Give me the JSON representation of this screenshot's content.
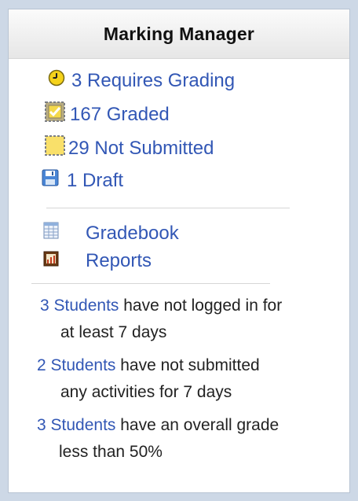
{
  "widget": {
    "title": "Marking Manager"
  },
  "grading": {
    "requires_grading": "3 Requires Grading",
    "graded": "167 Graded",
    "not_submitted": "29 Not Submitted",
    "draft": "1 Draft"
  },
  "tools": {
    "gradebook": "Gradebook",
    "reports": "Reports"
  },
  "alerts": [
    {
      "link": "3 Students",
      "line1": " have not logged in for",
      "line2": "at least 7 days"
    },
    {
      "link": "2 Students",
      "line1": " have not submitted",
      "line2": "any activities for 7 days"
    },
    {
      "link": "3 Students",
      "line1": " have an overall grade",
      "line2": "less than 50%"
    }
  ],
  "icons": {
    "clock": "clock-icon",
    "check": "checked-box-icon",
    "empty": "dashed-box-icon",
    "draft": "save-disk-icon",
    "gradebook": "spreadsheet-icon",
    "reports": "report-chart-icon"
  },
  "colors": {
    "link": "#3257b5",
    "frame": "#cdd8e6",
    "clock_yellow": "#f5d21a"
  }
}
